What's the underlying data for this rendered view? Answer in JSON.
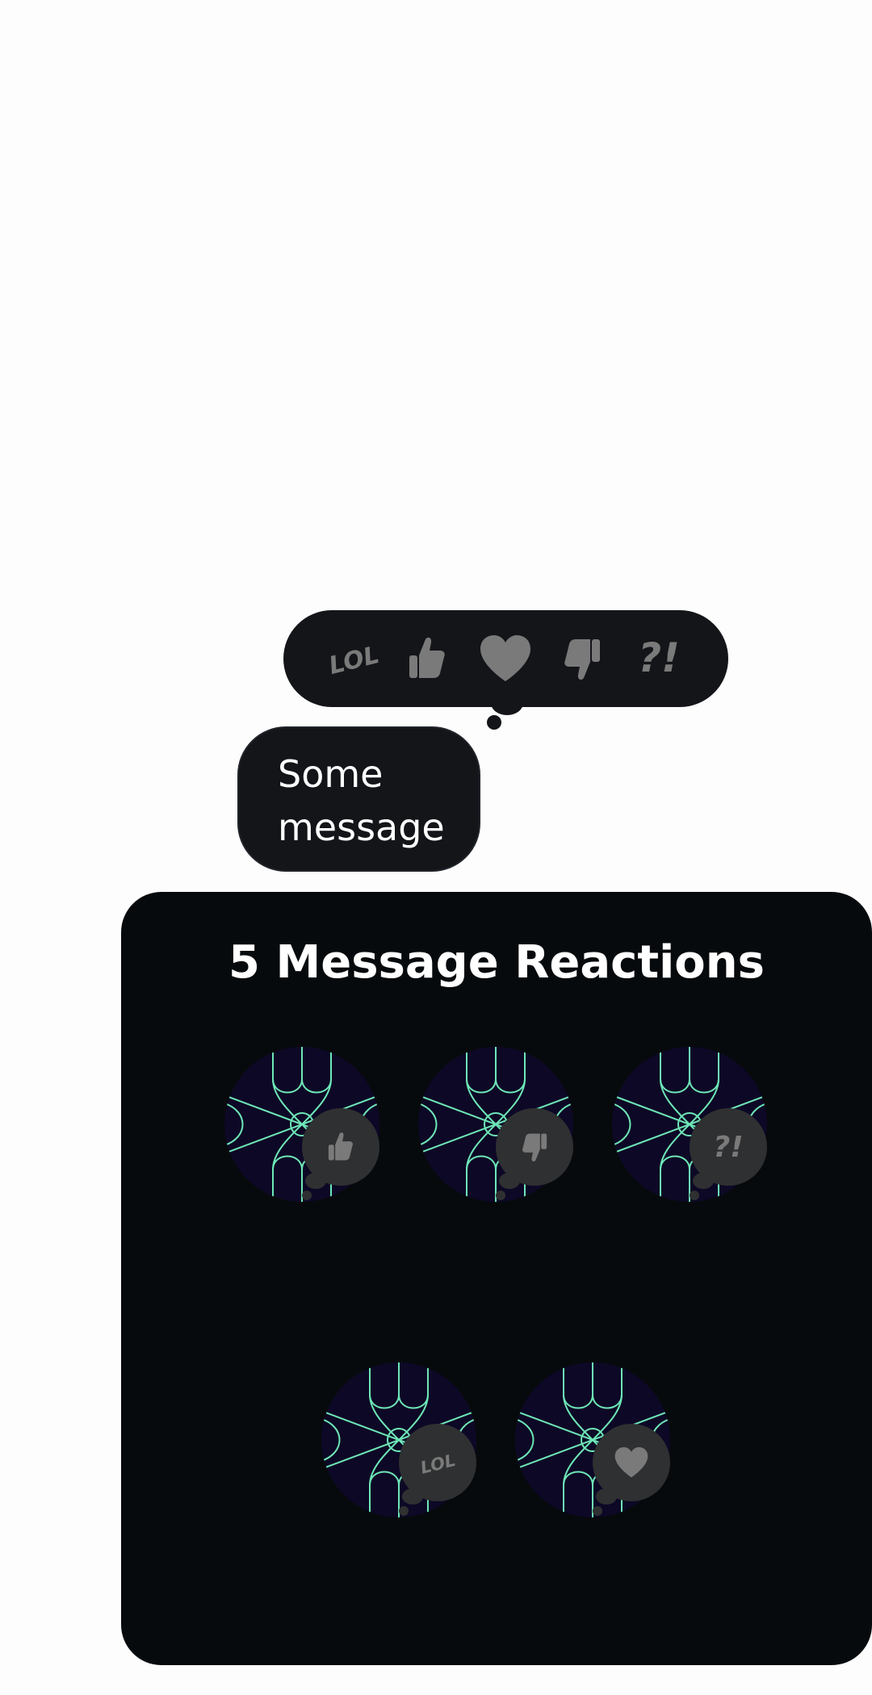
{
  "picker": {
    "reactions": [
      {
        "name": "lol",
        "icon": "lol-icon",
        "label": "LOL"
      },
      {
        "name": "thumbs-up",
        "icon": "thumbs-up-icon"
      },
      {
        "name": "heart",
        "icon": "heart-icon"
      },
      {
        "name": "thumbs-down",
        "icon": "thumbs-down-icon"
      },
      {
        "name": "question-exclamation",
        "icon": "question-exclamation-icon",
        "label": "?!"
      }
    ]
  },
  "message": {
    "line1": "Some",
    "line2": "message"
  },
  "panel": {
    "title": "5 Message Reactions",
    "reactors": [
      {
        "reaction": "thumbs-up-icon"
      },
      {
        "reaction": "thumbs-down-icon"
      },
      {
        "reaction": "question-exclamation-icon",
        "label": "?!"
      },
      {
        "reaction": "lol-icon",
        "label": "LOL"
      },
      {
        "reaction": "heart-icon"
      }
    ]
  },
  "colors": {
    "background": "#fdfdfd",
    "bubble": "#131519",
    "panel": "#070a0d",
    "icon": "#7a7a7a",
    "badge": "#2f3031",
    "avatar_bg": "#0d0826",
    "avatar_pattern": "#6ee7b7"
  }
}
